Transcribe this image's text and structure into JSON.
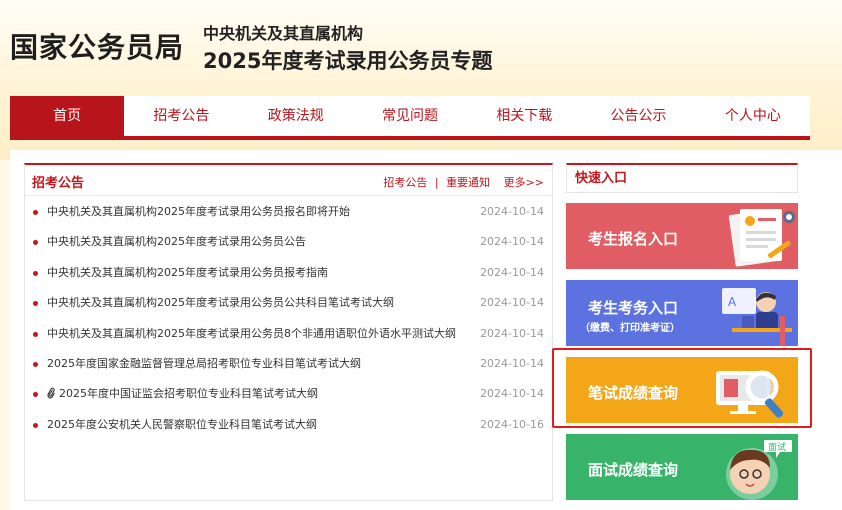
{
  "header": {
    "logo": "国家公务员局",
    "subtitle_line1": "中央机关及其直属机构",
    "subtitle_line2": "2025年度考试录用公务员专题"
  },
  "nav": {
    "items": [
      {
        "label": "首页",
        "active": true
      },
      {
        "label": "招考公告"
      },
      {
        "label": "政策法规"
      },
      {
        "label": "常见问题"
      },
      {
        "label": "相关下载"
      },
      {
        "label": "公告公示"
      },
      {
        "label": "个人中心"
      }
    ]
  },
  "news": {
    "title": "招考公告",
    "link_announce": "招考公告",
    "link_separator": "|",
    "link_notice": "重要通知",
    "more": "更多>>",
    "items": [
      {
        "text": "中央机关及其直属机构2025年度考试录用公务员报名即将开始",
        "date": "2024-10-14"
      },
      {
        "text": "中央机关及其直属机构2025年度考试录用公务员公告",
        "date": "2024-10-14"
      },
      {
        "text": "中央机关及其直属机构2025年度考试录用公务员报考指南",
        "date": "2024-10-14"
      },
      {
        "text": "中央机关及其直属机构2025年度考试录用公务员公共科目笔试考试大纲",
        "date": "2024-10-14"
      },
      {
        "text": "中央机关及其直属机构2025年度考试录用公务员8个非通用语职位外语水平测试大纲",
        "date": "2024-10-14"
      },
      {
        "text": "2025年度国家金融监督管理总局招考职位专业科目笔试考试大纲",
        "date": "2024-10-14"
      },
      {
        "text": "2025年度中国证监会招考职位专业科目笔试考试大纲",
        "date": "2024-10-14"
      },
      {
        "text": "2025年度公安机关人民警察职位专业科目笔试考试大纲",
        "date": "2024-10-16"
      }
    ]
  },
  "quick": {
    "title": "快速入口",
    "card1": {
      "label": "考生报名入口",
      "color": "#e05e63"
    },
    "card2": {
      "label": "考生考务入口",
      "sub": "（缴费、打印准考证）",
      "color": "#5c72e0"
    },
    "card3": {
      "label": "笔试成绩查询",
      "color": "#f4a619"
    },
    "card4": {
      "label": "面试成绩查询",
      "bubble": "面试",
      "color": "#37b36a"
    }
  }
}
